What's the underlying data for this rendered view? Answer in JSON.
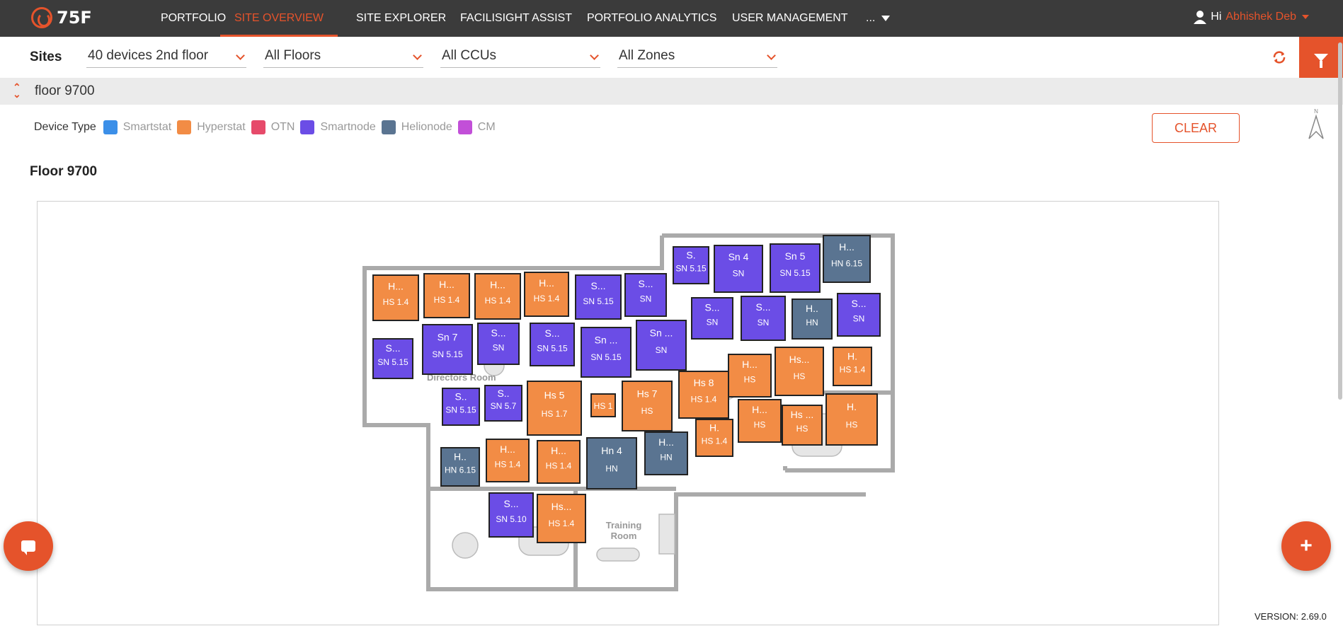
{
  "brand": {
    "logo_text": "75F",
    "accent": "#e5532b"
  },
  "nav": {
    "items": [
      "PORTFOLIO",
      "SITE OVERVIEW",
      "SITE EXPLORER",
      "FACILISIGHT ASSIST",
      "PORTFOLIO ANALYTICS",
      "USER MANAGEMENT",
      "..."
    ],
    "active": "SITE OVERVIEW",
    "user_greeting": "Hi",
    "user_name": "Abhishek Deb"
  },
  "filters": {
    "sites_label": "Sites",
    "site": "40 devices 2nd floor",
    "floor": "All Floors",
    "ccu": "All CCUs",
    "zone": "All Zones"
  },
  "floor_bar": {
    "name": "floor 9700"
  },
  "legend": {
    "title": "Device Type",
    "items": [
      {
        "label": "Smartstat",
        "color": "#3b8fe8"
      },
      {
        "label": "Hyperstat",
        "color": "#f28c45"
      },
      {
        "label": "OTN",
        "color": "#e64a6a"
      },
      {
        "label": "Smartnode",
        "color": "#6b4de6"
      },
      {
        "label": "Helionode",
        "color": "#5a7491"
      },
      {
        "label": "CM",
        "color": "#c24fd8"
      }
    ]
  },
  "clear_label": "CLEAR",
  "north_label": "N",
  "floor_title": "Floor 9700",
  "plan_labels": {
    "directors_room": "Directors Room",
    "training_room": "Training Room"
  },
  "devices": [
    {
      "type": "Hyperstat",
      "name": "H...",
      "sub": "HS 1.4"
    },
    {
      "type": "Hyperstat",
      "name": "H...",
      "sub": "HS 1.4"
    },
    {
      "type": "Hyperstat",
      "name": "H...",
      "sub": "HS 1.4"
    },
    {
      "type": "Hyperstat",
      "name": "H...",
      "sub": "HS 1.4"
    },
    {
      "type": "Smartnode",
      "name": "S...",
      "sub": "SN 5.15"
    },
    {
      "type": "Smartnode",
      "name": "S...",
      "sub": "SN"
    },
    {
      "type": "Smartnode",
      "name": "S.",
      "sub": "SN 5.15"
    },
    {
      "type": "Smartnode",
      "name": "Sn 4",
      "sub": "SN"
    },
    {
      "type": "Smartnode",
      "name": "Sn 5",
      "sub": "SN 5.15"
    },
    {
      "type": "Helionode",
      "name": "H...",
      "sub": "HN 6.15"
    },
    {
      "type": "Smartnode",
      "name": "S...",
      "sub": "SN 5.15"
    },
    {
      "type": "Smartnode",
      "name": "Sn 7",
      "sub": "SN 5.15"
    },
    {
      "type": "Smartnode",
      "name": "S...",
      "sub": "SN"
    },
    {
      "type": "Smartnode",
      "name": "S...",
      "sub": "SN 5.15"
    },
    {
      "type": "Smartnode",
      "name": "Sn ...",
      "sub": "SN 5.15"
    },
    {
      "type": "Smartnode",
      "name": "Sn ...",
      "sub": "SN"
    },
    {
      "type": "Smartnode",
      "name": "S...",
      "sub": "SN"
    },
    {
      "type": "Smartnode",
      "name": "S...",
      "sub": "SN"
    },
    {
      "type": "Helionode",
      "name": "H..",
      "sub": "HN"
    },
    {
      "type": "Smartnode",
      "name": "S...",
      "sub": "SN"
    },
    {
      "type": "Hyperstat",
      "name": "Hs...",
      "sub": "HS"
    },
    {
      "type": "Hyperstat",
      "name": "H.",
      "sub": "HS 1.4"
    },
    {
      "type": "Hyperstat",
      "name": "H...",
      "sub": "HS"
    },
    {
      "type": "Hyperstat",
      "name": "Hs 8",
      "sub": "HS 1.4"
    },
    {
      "type": "Smartnode",
      "name": "S..",
      "sub": "SN 5.15"
    },
    {
      "type": "Smartnode",
      "name": "S..",
      "sub": "SN 5.7"
    },
    {
      "type": "Hyperstat",
      "name": "Hs 5",
      "sub": "HS 1.7"
    },
    {
      "type": "Hyperstat",
      "name": "",
      "sub": "HS 1"
    },
    {
      "type": "Hyperstat",
      "name": "Hs 7",
      "sub": "HS"
    },
    {
      "type": "Hyperstat",
      "name": "H.",
      "sub": "HS 1.4"
    },
    {
      "type": "Hyperstat",
      "name": "H...",
      "sub": "HS"
    },
    {
      "type": "Hyperstat",
      "name": "Hs ...",
      "sub": "HS"
    },
    {
      "type": "Hyperstat",
      "name": "H.",
      "sub": "HS"
    },
    {
      "type": "Helionode",
      "name": "H..",
      "sub": "HN 6.15"
    },
    {
      "type": "Hyperstat",
      "name": "H...",
      "sub": "HS 1.4"
    },
    {
      "type": "Hyperstat",
      "name": "H...",
      "sub": "HS 1.4"
    },
    {
      "type": "Helionode",
      "name": "Hn 4",
      "sub": "HN"
    },
    {
      "type": "Helionode",
      "name": "H...",
      "sub": "HN"
    },
    {
      "type": "Smartnode",
      "name": "S...",
      "sub": "SN 5.10"
    },
    {
      "type": "Hyperstat",
      "name": "Hs...",
      "sub": "HS 1.4"
    }
  ],
  "version": "VERSION: 2.69.0"
}
